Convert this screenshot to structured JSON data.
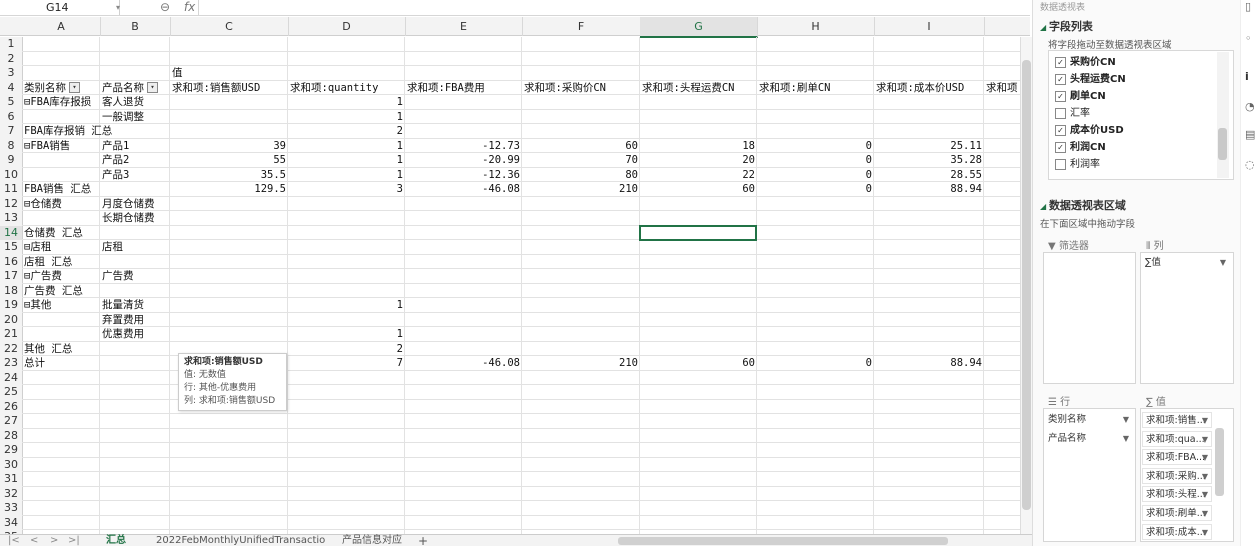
{
  "formula_bar": {
    "name_box": "G14",
    "fx_icons": [
      "⊖",
      "fx"
    ],
    "formula": ""
  },
  "columns": [
    "A",
    "B",
    "C",
    "D",
    "E",
    "F",
    "G",
    "H",
    "I"
  ],
  "selected_column": "G",
  "selected_row": "14",
  "rows": [
    {
      "n": "1",
      "cells": {}
    },
    {
      "n": "2",
      "cells": {}
    },
    {
      "n": "3",
      "cells": {
        "C": "值"
      }
    },
    {
      "n": "4",
      "cells": {
        "A": "类别名称",
        "B": "产品名称",
        "C": "求和项:销售额USD",
        "D": "求和项:quantity",
        "E": "求和项:FBA费用",
        "F": "求和项:采购价CN",
        "G": "求和项:头程运费CN",
        "H": "求和项:刷单CN",
        "I": "求和项:成本价USD",
        "J": "求和项"
      }
    },
    {
      "n": "5",
      "cells": {
        "A": "⊟FBA库存报损",
        "B": "客人退货",
        "D": "1"
      }
    },
    {
      "n": "6",
      "cells": {
        "B": "一般调整",
        "D": "1"
      }
    },
    {
      "n": "7",
      "cells": {
        "A": "FBA库存报销 汇总",
        "D": "2"
      }
    },
    {
      "n": "8",
      "cells": {
        "A": "⊟FBA销售",
        "B": "产品1",
        "C": "39",
        "D": "1",
        "E": "-12.73",
        "F": "60",
        "G": "18",
        "H": "0",
        "I": "25.11"
      }
    },
    {
      "n": "9",
      "cells": {
        "B": "产品2",
        "C": "55",
        "D": "1",
        "E": "-20.99",
        "F": "70",
        "G": "20",
        "H": "0",
        "I": "35.28"
      }
    },
    {
      "n": "10",
      "cells": {
        "B": "产品3",
        "C": "35.5",
        "D": "1",
        "E": "-12.36",
        "F": "80",
        "G": "22",
        "H": "0",
        "I": "28.55"
      }
    },
    {
      "n": "11",
      "cells": {
        "A": "FBA销售 汇总",
        "C": "129.5",
        "D": "3",
        "E": "-46.08",
        "F": "210",
        "G": "60",
        "H": "0",
        "I": "88.94"
      }
    },
    {
      "n": "12",
      "cells": {
        "A": "⊟仓储费",
        "B": "月度仓储费"
      }
    },
    {
      "n": "13",
      "cells": {
        "B": "长期仓储费"
      }
    },
    {
      "n": "14",
      "cells": {
        "A": "仓储费 汇总"
      }
    },
    {
      "n": "15",
      "cells": {
        "A": "⊟店租",
        "B": "店租"
      }
    },
    {
      "n": "16",
      "cells": {
        "A": "店租 汇总"
      }
    },
    {
      "n": "17",
      "cells": {
        "A": "⊟广告费",
        "B": "广告费"
      }
    },
    {
      "n": "18",
      "cells": {
        "A": "广告费 汇总"
      }
    },
    {
      "n": "19",
      "cells": {
        "A": "⊟其他",
        "B": "批量清货",
        "D": "1"
      }
    },
    {
      "n": "20",
      "cells": {
        "B": "弃置费用"
      }
    },
    {
      "n": "21",
      "cells": {
        "B": "优惠费用",
        "D": "1"
      }
    },
    {
      "n": "22",
      "cells": {
        "A": "其他 汇总",
        "D": "2"
      }
    },
    {
      "n": "23",
      "cells": {
        "A": "总计",
        "D": "7",
        "E": "-46.08",
        "F": "210",
        "G": "60",
        "H": "0",
        "I": "88.94"
      }
    },
    {
      "n": "24",
      "cells": {}
    },
    {
      "n": "25",
      "cells": {}
    },
    {
      "n": "26",
      "cells": {}
    },
    {
      "n": "27",
      "cells": {}
    },
    {
      "n": "28",
      "cells": {}
    },
    {
      "n": "29",
      "cells": {}
    },
    {
      "n": "30",
      "cells": {}
    },
    {
      "n": "31",
      "cells": {}
    },
    {
      "n": "32",
      "cells": {}
    },
    {
      "n": "33",
      "cells": {}
    },
    {
      "n": "34",
      "cells": {}
    },
    {
      "n": "35",
      "cells": {}
    }
  ],
  "tooltip": {
    "title": "求和项:销售额USD",
    "line1": "值: 无数值",
    "line2": "行: 其他-优惠费用",
    "line3": "列: 求和项:销售额USD"
  },
  "sheet_tabs": {
    "nav": [
      "|<",
      "<",
      ">",
      ">|"
    ],
    "tabs": [
      "汇总",
      "2022FebMonthlyUnifiedTransactio",
      "产品信息对应"
    ],
    "active": "汇总",
    "add": "+"
  },
  "pane": {
    "header_title": "数据透视表",
    "field_list_title": "字段列表",
    "field_list_hint": "将字段拖动至数据透视表区域",
    "fields": [
      {
        "label": "采购价CN",
        "checked": true
      },
      {
        "label": "头程运费CN",
        "checked": true
      },
      {
        "label": "刷单CN",
        "checked": true
      },
      {
        "label": "汇率",
        "checked": false
      },
      {
        "label": "成本价USD",
        "checked": true
      },
      {
        "label": "利润CN",
        "checked": true
      },
      {
        "label": "利润率",
        "checked": false
      }
    ],
    "areas_title": "数据透视表区域",
    "areas_hint": "在下面区域中拖动字段",
    "filter_label": "筛选器",
    "columns_label": "列",
    "columns_items": [
      "∑值"
    ],
    "rows_label": "行",
    "values_label": "值",
    "rows_items": [
      "类别名称",
      "产品名称"
    ],
    "values_items": [
      "求和项:销售...",
      "求和项:qua...",
      "求和项:FBA...",
      "求和项:采购...",
      "求和项:头程...",
      "求和项:刷单...",
      "求和项:成本..."
    ]
  },
  "accent_color": "#217346"
}
